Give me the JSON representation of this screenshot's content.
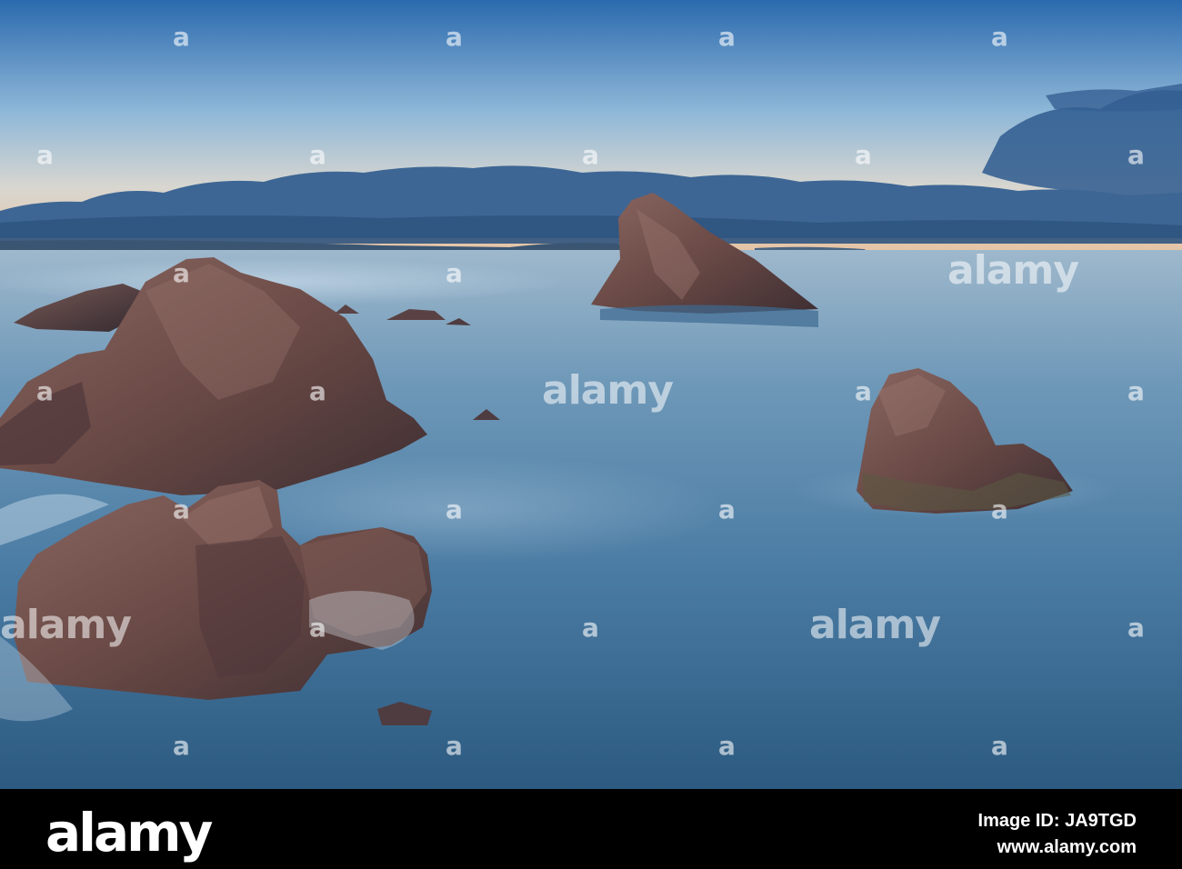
{
  "watermark": {
    "brand": "alamy",
    "mark": "a"
  },
  "footer": {
    "logo": "alamy",
    "image_id": "Image ID: JA9TGD",
    "url": "www.alamy.com"
  },
  "colors": {
    "sky_top": "#2f6fae",
    "sky_horizon": "#e8c8a8",
    "sea": "#4a7ea8",
    "rock": "#6a4a44",
    "footer_bg": "#000000"
  }
}
